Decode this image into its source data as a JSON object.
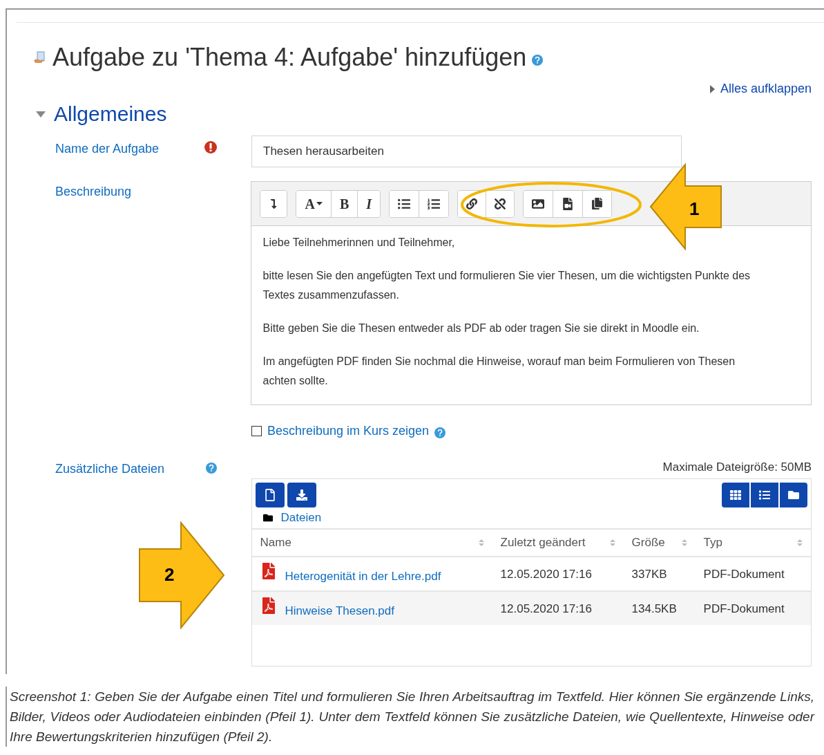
{
  "page_title": "Aufgabe zu 'Thema 4: Aufgabe' hinzufügen",
  "expand_all": "Alles aufklappen",
  "section": {
    "title": "Allgemeines",
    "expanded": true
  },
  "name_field": {
    "label": "Name der Aufgabe",
    "value": "Thesen herausarbeiten",
    "required": true
  },
  "description": {
    "label": "Beschreibung",
    "paragraphs": [
      "Liebe Teilnehmerinnen und Teilnehmer,",
      "bitte lesen Sie den angefügten Text und formulieren Sie vier Thesen, um die wichtigsten Punkte des Textes zusammenzufassen.",
      "Bitte geben Sie die Thesen entweder als PDF ab oder tragen Sie sie direkt in Moodle ein.",
      "Im angefügten PDF finden Sie nochmal die Hinweise, worauf man beim Formulieren von Thesen achten sollte."
    ]
  },
  "toolbar_labels": {
    "font_size": "A",
    "bold": "B",
    "italic": "I"
  },
  "show_in_course": {
    "label": "Beschreibung im Kurs zeigen",
    "checked": false
  },
  "files": {
    "label": "Zusätzliche Dateien",
    "max_size": "Maximale Dateigröße: 50MB",
    "path": "Dateien",
    "columns": [
      "Name",
      "Zuletzt geändert",
      "Größe",
      "Typ"
    ],
    "rows": [
      {
        "name": "Heterogenität in der Lehre.pdf",
        "modified": "12.05.2020 17:16",
        "size": "337KB",
        "type": "PDF-Dokument"
      },
      {
        "name": "Hinweise Thesen.pdf",
        "modified": "12.05.2020 17:16",
        "size": "134.5KB",
        "type": "PDF-Dokument"
      }
    ]
  },
  "callouts": [
    "1",
    "2"
  ],
  "caption": "Screenshot 1: Geben Sie der Aufgabe einen Titel und formulieren Sie Ihren Arbeitsauftrag im Textfeld. Hier können Sie ergänzende Links, Bilder, Videos oder Audiodateien einbinden (Pfeil 1). Unter dem Textfeld können Sie zusätzliche Dateien, wie Quellentexte, Hinweise oder Ihre Bewertungskriterien hinzufügen (Pfeil 2)."
}
